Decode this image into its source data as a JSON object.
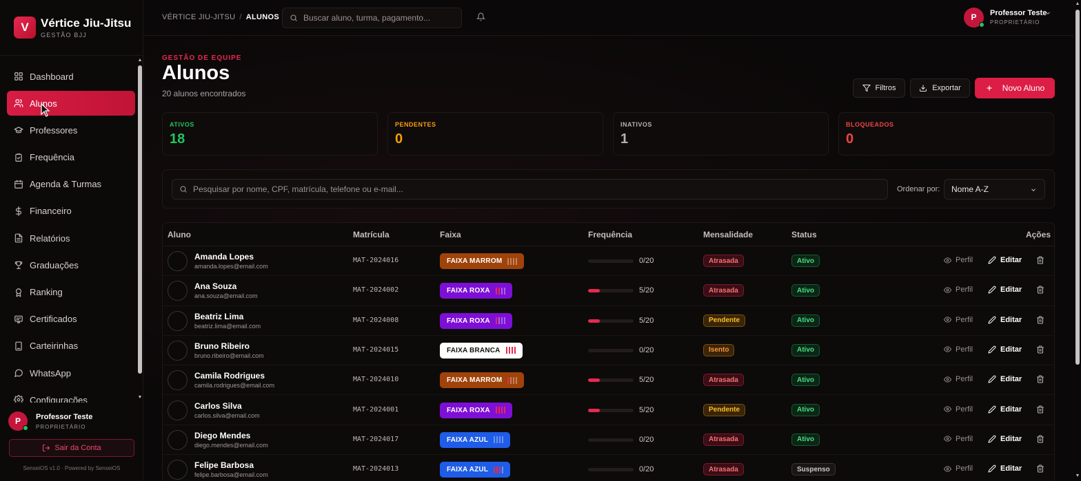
{
  "brand": {
    "logo_letter": "V",
    "title": "Vértice Jiu-Jitsu",
    "subtitle": "GESTÃO BJJ"
  },
  "sidebar": {
    "items": [
      {
        "label": "Dashboard",
        "icon": "grid-icon",
        "active": false
      },
      {
        "label": "Alunos",
        "icon": "users-icon",
        "active": true
      },
      {
        "label": "Professores",
        "icon": "graduation-cap-icon",
        "active": false
      },
      {
        "label": "Frequência",
        "icon": "clipboard-check-icon",
        "active": false
      },
      {
        "label": "Agenda & Turmas",
        "icon": "calendar-icon",
        "active": false
      },
      {
        "label": "Financeiro",
        "icon": "dollar-icon",
        "active": false
      },
      {
        "label": "Relatórios",
        "icon": "file-text-icon",
        "active": false
      },
      {
        "label": "Graduações",
        "icon": "trophy-icon",
        "active": false
      },
      {
        "label": "Ranking",
        "icon": "award-icon",
        "active": false
      },
      {
        "label": "Certificados",
        "icon": "certificate-icon",
        "active": false
      },
      {
        "label": "Carteirinhas",
        "icon": "id-card-icon",
        "active": false
      },
      {
        "label": "WhatsApp",
        "icon": "chat-icon",
        "active": false
      },
      {
        "label": "Configurações",
        "icon": "gear-icon",
        "active": false
      }
    ],
    "user": {
      "initial": "P",
      "name": "Professor Teste",
      "role": "PROPRIETÁRIO"
    },
    "logout_label": "Sair da Conta",
    "footer": "SenseiOS v1.0 · Powered by SenseiOS"
  },
  "topbar": {
    "breadcrumb": {
      "root": "VÉRTICE JIU-JITSU",
      "separator": "/",
      "current": "ALUNOS"
    },
    "search_placeholder": "Buscar aluno, turma, pagamento...",
    "user": {
      "initial": "P",
      "name": "Professor Teste",
      "role": "PROPRIETÁRIO"
    }
  },
  "page": {
    "eyebrow": "GESTÃO DE EQUIPE",
    "title": "Alunos",
    "subtitle": "20 alunos encontrados",
    "buttons": {
      "filters": "Filtros",
      "export": "Exportar",
      "new": "Novo Aluno"
    }
  },
  "stats": [
    {
      "label": "ATIVOS",
      "value": "18",
      "color": "#22c55e"
    },
    {
      "label": "PENDENTES",
      "value": "0",
      "color": "#f59e0b"
    },
    {
      "label": "INATIVOS",
      "value": "1",
      "color": "#b8b0b0"
    },
    {
      "label": "BLOQUEADOS",
      "value": "0",
      "color": "#ef4444"
    }
  ],
  "filters": {
    "search_placeholder": "Pesquisar por nome, CPF, matrícula, telefone ou e-mail...",
    "sort_label": "Ordenar por:",
    "sort_value": "Nome A-Z"
  },
  "table": {
    "columns": [
      "Aluno",
      "Matrícula",
      "Faixa",
      "Frequência",
      "Mensalidade",
      "Status",
      "Ações"
    ],
    "action_labels": {
      "profile": "Perfil",
      "edit": "Editar"
    },
    "rows": [
      {
        "name": "Amanda Lopes",
        "email": "amanda.lopes@email.com",
        "matricula": "MAT-2024016",
        "belt": "FAIXA MARROM",
        "belt_color": "#a0430a",
        "stripes_on": 0,
        "freq": "0/20",
        "freq_pct": 0,
        "fee": "Atrasada",
        "status": "Ativo"
      },
      {
        "name": "Ana Souza",
        "email": "ana.souza@email.com",
        "matricula": "MAT-2024002",
        "belt": "FAIXA ROXA",
        "belt_color": "#7e0fd6",
        "stripes_on": 2,
        "freq": "5/20",
        "freq_pct": 25,
        "fee": "Atrasada",
        "status": "Ativo"
      },
      {
        "name": "Beatriz Lima",
        "email": "beatriz.lima@email.com",
        "matricula": "MAT-2024008",
        "belt": "FAIXA ROXA",
        "belt_color": "#7e0fd6",
        "stripes_on": 1,
        "freq": "5/20",
        "freq_pct": 25,
        "fee": "Pendente",
        "status": "Ativo"
      },
      {
        "name": "Bruno Ribeiro",
        "email": "bruno.ribeiro@email.com",
        "matricula": "MAT-2024015",
        "belt": "FAIXA BRANCA",
        "belt_color": "#ffffff",
        "stripes_on": 4,
        "freq": "0/20",
        "freq_pct": 0,
        "fee": "Isento",
        "status": "Ativo"
      },
      {
        "name": "Camila Rodrigues",
        "email": "camila.rodrigues@email.com",
        "matricula": "MAT-2024010",
        "belt": "FAIXA MARROM",
        "belt_color": "#a0430a",
        "stripes_on": 1,
        "freq": "5/20",
        "freq_pct": 25,
        "fee": "Atrasada",
        "status": "Ativo"
      },
      {
        "name": "Carlos Silva",
        "email": "carlos.silva@email.com",
        "matricula": "MAT-2024001",
        "belt": "FAIXA ROXA",
        "belt_color": "#7e0fd6",
        "stripes_on": 4,
        "freq": "5/20",
        "freq_pct": 25,
        "fee": "Pendente",
        "status": "Ativo"
      },
      {
        "name": "Diego Mendes",
        "email": "diego.mendes@email.com",
        "matricula": "MAT-2024017",
        "belt": "FAIXA AZUL",
        "belt_color": "#1f5ce8",
        "stripes_on": 0,
        "freq": "0/20",
        "freq_pct": 0,
        "fee": "Atrasada",
        "status": "Ativo"
      },
      {
        "name": "Felipe Barbosa",
        "email": "felipe.barbosa@email.com",
        "matricula": "MAT-2024013",
        "belt": "FAIXA AZUL",
        "belt_color": "#1f5ce8",
        "stripes_on": 3,
        "freq": "0/20",
        "freq_pct": 0,
        "fee": "Atrasada",
        "status": "Suspenso"
      }
    ]
  }
}
